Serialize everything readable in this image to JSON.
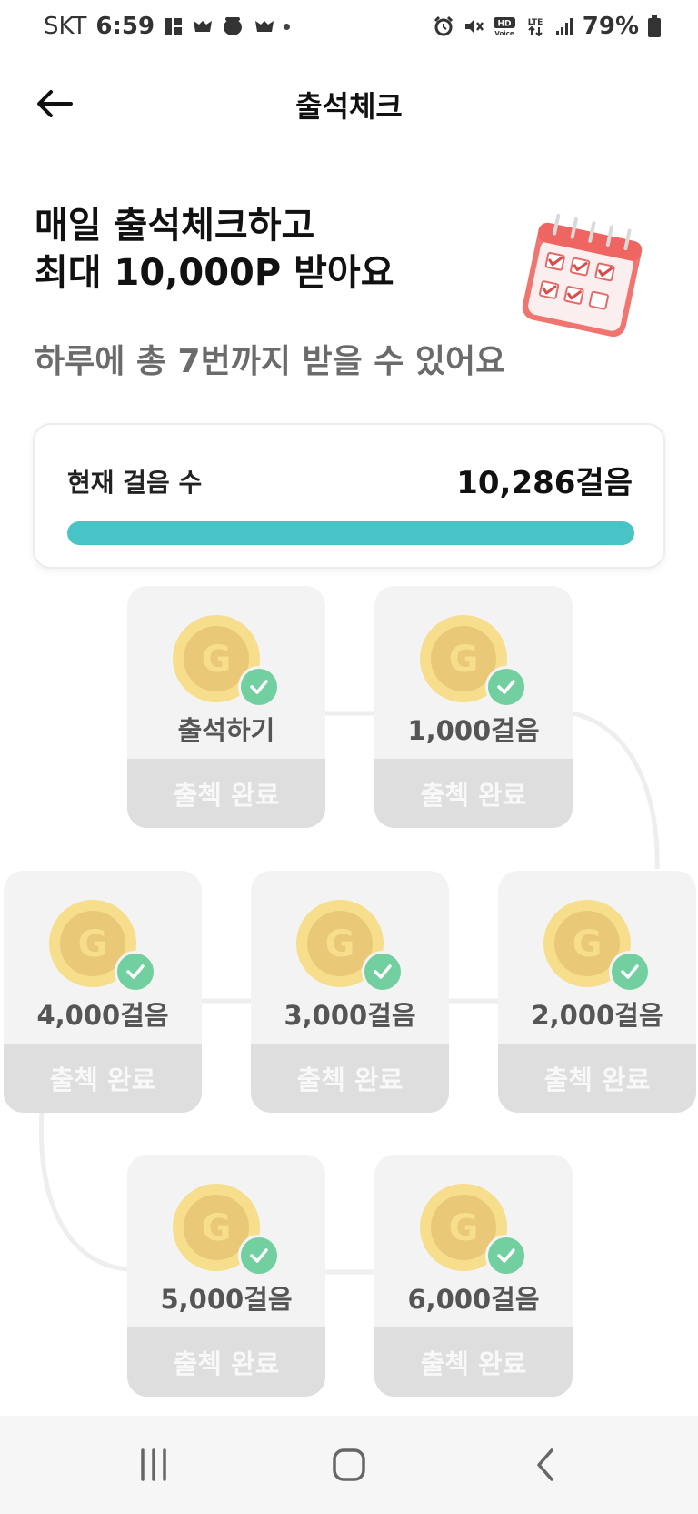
{
  "status_bar": {
    "carrier": "SKT",
    "time": "6:59",
    "battery": "79%",
    "icons_left": [
      "gallery-icon",
      "game-icon",
      "cup-icon",
      "game-icon",
      "dot-icon"
    ],
    "icons_right": [
      "alarm-icon",
      "mute-icon",
      "hd-voice-icon",
      "lte-icon",
      "signal-icon",
      "battery-icon"
    ]
  },
  "header": {
    "title": "출석체크",
    "back_icon": "arrow-left-icon"
  },
  "intro": {
    "headline_line1": "매일 출석체크하고",
    "headline_line2": "최대 10,000P 받아요",
    "subtitle": "하루에 총 7번까지 받을 수 있어요",
    "illustration": "calendar-icon"
  },
  "steps": {
    "label": "현재 걸음 수",
    "value": "10,286걸음",
    "progress": 1.0,
    "progress_color": "#48c3c6"
  },
  "rewards": [
    {
      "label": "출석하기",
      "status": "출첵 완료"
    },
    {
      "label": "1,000걸음",
      "status": "출첵 완료"
    },
    {
      "label": "2,000걸음",
      "status": "출첵 완료"
    },
    {
      "label": "3,000걸음",
      "status": "출첵 완료"
    },
    {
      "label": "4,000걸음",
      "status": "출첵 완료"
    },
    {
      "label": "5,000걸음",
      "status": "출첵 완료"
    },
    {
      "label": "6,000걸음",
      "status": "출첵 완료"
    }
  ],
  "colors": {
    "coin_outer": "#f6de8c",
    "coin_inner": "#e9c877",
    "check_green": "#72cf9f",
    "tile_bg": "#f3f3f3",
    "status_bg": "#dedede"
  },
  "navbar": {
    "recents_icon": "recents-icon",
    "home_icon": "home-icon",
    "back_icon": "back-icon"
  }
}
